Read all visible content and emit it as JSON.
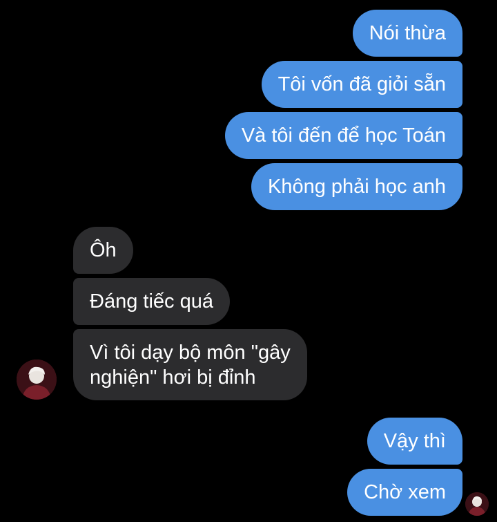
{
  "conversation": {
    "outgoing_first": [
      "Nói thừa",
      "Tôi vốn đã giỏi sẵn",
      "Và tôi đến để học Toán",
      "Không phải học anh"
    ],
    "incoming": [
      "Ôh",
      "Đáng tiếc quá",
      "Vì tôi dạy bộ môn \"gây",
      "nghiện\" hơi bị đỉnh"
    ],
    "outgoing_second": [
      "Vậy thì",
      "Chờ xem"
    ]
  },
  "colors": {
    "background": "#000000",
    "outgoing_bubble": "#4a90e2",
    "incoming_bubble": "#2c2c2e",
    "text": "#ffffff"
  },
  "icons": {
    "contact_avatar": "user-avatar-icon",
    "read_receipt": "read-receipt-avatar-icon"
  }
}
